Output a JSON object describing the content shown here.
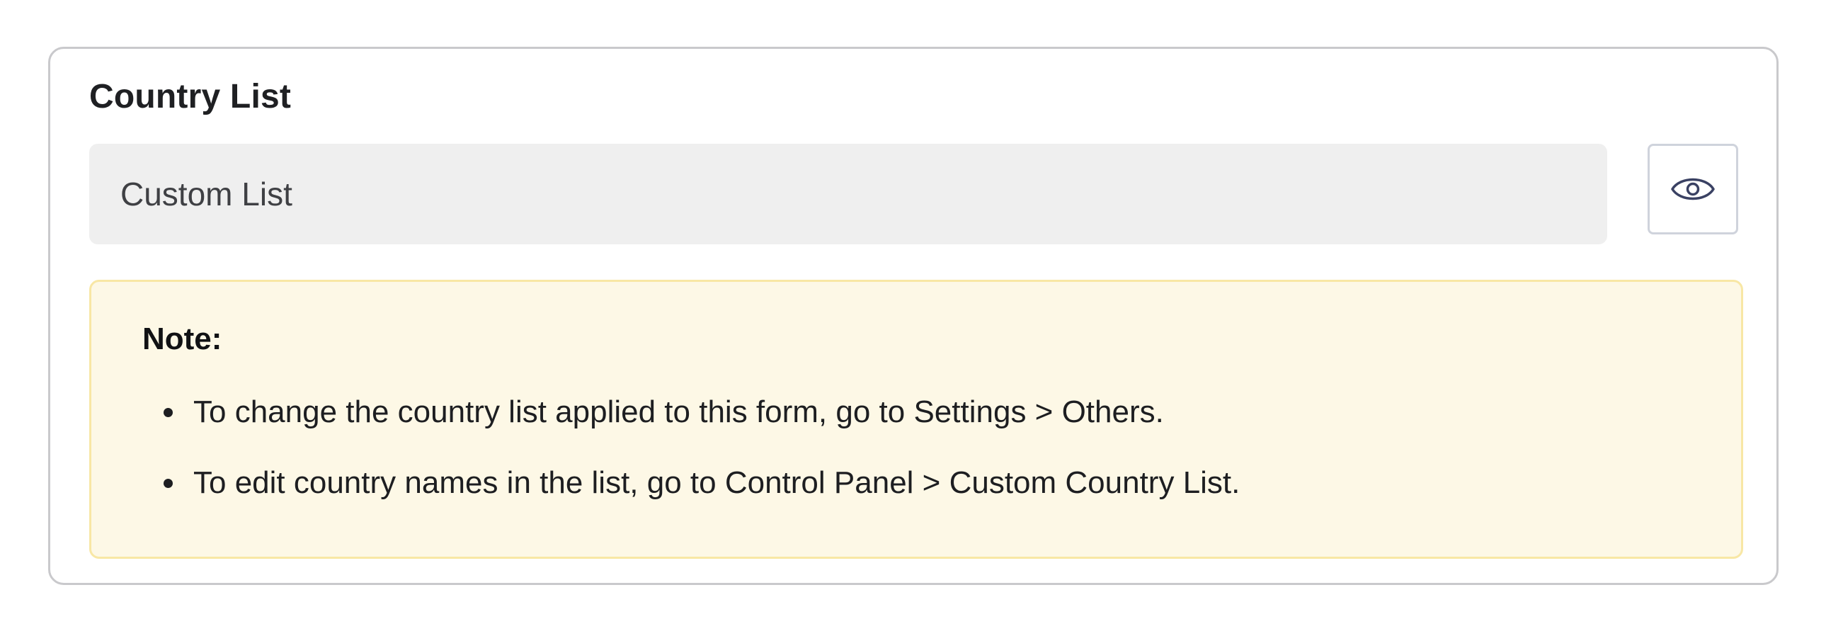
{
  "field": {
    "label": "Country List",
    "selected_value": "Custom List"
  },
  "preview_button": {
    "icon": "eye-icon"
  },
  "note": {
    "title": "Note:",
    "items": [
      {
        "text": "To change the country list applied to this form, go to Settings > Others."
      },
      {
        "text": "To edit country names in the list, go to Control Panel > Custom Country List."
      }
    ]
  },
  "colors": {
    "note_background": "#fdf8e6",
    "note_border": "#f8e7a5",
    "field_background": "#efefef",
    "icon_stroke": "#3a4163"
  }
}
